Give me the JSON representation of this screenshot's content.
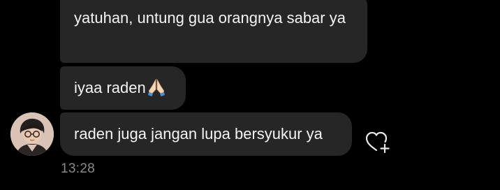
{
  "messages": [
    {
      "text": "yatuhan, untung gua orangnya sabar ya"
    },
    {
      "text": "iyaa raden",
      "emoji": "folded-hands-emoji"
    },
    {
      "text": "raden juga jangan lupa bersyukur ya"
    }
  ],
  "timestamp": "13:28",
  "icons": {
    "avatar": "sender-avatar",
    "reaction": "heart-add-icon"
  },
  "colors": {
    "background": "#000000",
    "bubble": "#262626",
    "text": "#f4f4f4",
    "timestamp": "#8a8a8a"
  }
}
